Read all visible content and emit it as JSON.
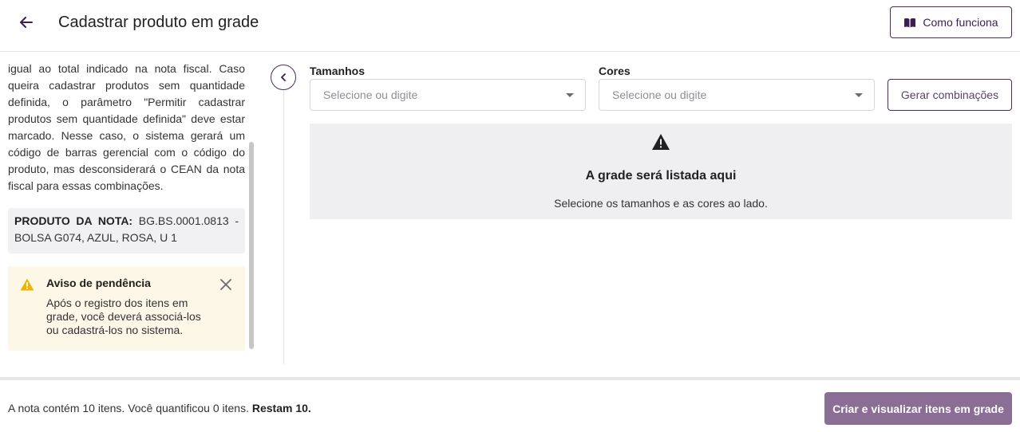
{
  "header": {
    "title": "Cadastrar produto em grade",
    "how_button_label": "Como funciona"
  },
  "left_panel": {
    "info_text": "igual ao total indicado na nota fiscal. Caso queira cadastrar produtos sem quantidade definida, o parâmetro \"Permitir cadastrar produtos sem quantidade definida\" deve estar marcado. Nesse caso, o sistema gerará um código de barras gerencial com o código do produto, mas desconsiderará o CEAN da nota fiscal para essas combinações.",
    "product_label": "PRODUTO DA NOTA:",
    "product_value": "BG.BS.0001.0813 - BOLSA G074, AZUL, ROSA, U 1",
    "warning": {
      "title": "Aviso de pendência",
      "body": "Após o registro dos itens em grade, você deverá associá-los ou cadastrá-los no sistema."
    }
  },
  "filters": {
    "sizes_label": "Tamanhos",
    "sizes_placeholder": "Selecione ou digite",
    "colors_label": "Cores",
    "colors_placeholder": "Selecione ou digite",
    "generate_label": "Gerar combinações"
  },
  "grid": {
    "empty_title": "A grade será listada aqui",
    "empty_subtitle": "Selecione os tamanhos e as cores ao lado."
  },
  "footer": {
    "summary_text": "A nota contém 10 itens. Você quantificou 0 itens.",
    "remaining_text": "Restam 10.",
    "create_label": "Criar e visualizar itens em grade"
  },
  "colors": {
    "primary": "#4b2b5f",
    "primary_disabled": "#8a6e96",
    "warning": "#f0b400",
    "warning_bg": "#fdf7e8"
  },
  "icons": {
    "back": "arrow-left-icon",
    "how": "book-open-icon",
    "collapse": "chevron-left-icon",
    "warning": "warning-triangle-icon",
    "close": "close-icon",
    "dropdown": "caret-down-icon",
    "alert": "alert-triangle-icon"
  }
}
